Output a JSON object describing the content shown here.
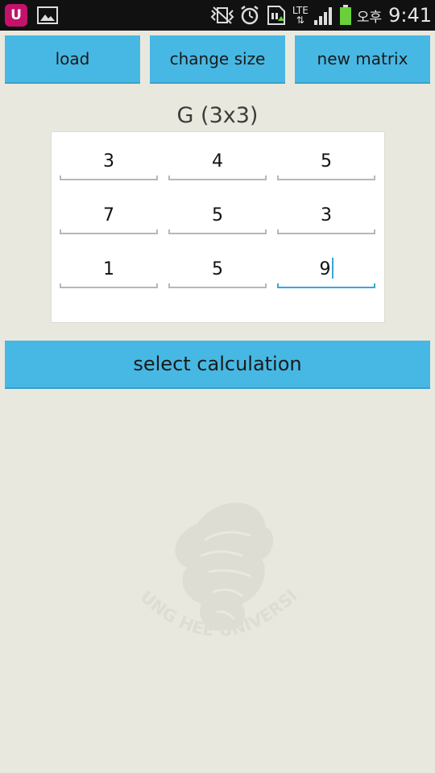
{
  "status_bar": {
    "carrier_logo": "U",
    "network": "LTE",
    "clock_prefix": "오후",
    "time": "9:41",
    "icons": [
      "uplus-icon",
      "gallery-icon",
      "vibrate-icon",
      "alarm-icon",
      "sdcard-icon",
      "lte-icon",
      "signal-icon",
      "battery-icon"
    ]
  },
  "toolbar": {
    "load_label": "load",
    "change_size_label": "change size",
    "new_matrix_label": "new matrix"
  },
  "matrix": {
    "title": "G (3x3)",
    "rows": [
      [
        "3",
        "4",
        "5"
      ],
      [
        "7",
        "5",
        "3"
      ],
      [
        "1",
        "5",
        "9"
      ]
    ],
    "focused_cell": "2,2"
  },
  "actions": {
    "select_calculation_label": "select calculation"
  },
  "watermark": {
    "text": "KYUNG HEE UNIVERSITY"
  },
  "colors": {
    "button": "#47b8e3",
    "background": "#e9e8de",
    "focus": "#39a7db",
    "status_bar": "#111111"
  }
}
